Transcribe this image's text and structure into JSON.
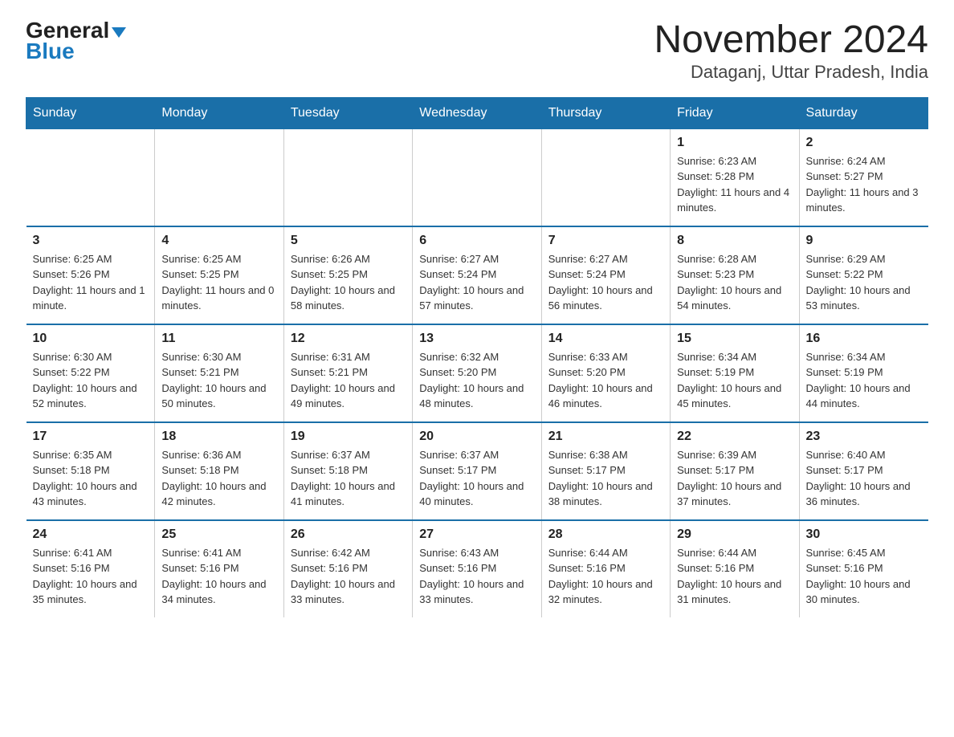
{
  "logo": {
    "general": "General",
    "blue": "Blue"
  },
  "title": "November 2024",
  "subtitle": "Dataganj, Uttar Pradesh, India",
  "weekdays": [
    "Sunday",
    "Monday",
    "Tuesday",
    "Wednesday",
    "Thursday",
    "Friday",
    "Saturday"
  ],
  "weeks": [
    [
      {
        "day": "",
        "info": ""
      },
      {
        "day": "",
        "info": ""
      },
      {
        "day": "",
        "info": ""
      },
      {
        "day": "",
        "info": ""
      },
      {
        "day": "",
        "info": ""
      },
      {
        "day": "1",
        "info": "Sunrise: 6:23 AM\nSunset: 5:28 PM\nDaylight: 11 hours and 4 minutes."
      },
      {
        "day": "2",
        "info": "Sunrise: 6:24 AM\nSunset: 5:27 PM\nDaylight: 11 hours and 3 minutes."
      }
    ],
    [
      {
        "day": "3",
        "info": "Sunrise: 6:25 AM\nSunset: 5:26 PM\nDaylight: 11 hours and 1 minute."
      },
      {
        "day": "4",
        "info": "Sunrise: 6:25 AM\nSunset: 5:25 PM\nDaylight: 11 hours and 0 minutes."
      },
      {
        "day": "5",
        "info": "Sunrise: 6:26 AM\nSunset: 5:25 PM\nDaylight: 10 hours and 58 minutes."
      },
      {
        "day": "6",
        "info": "Sunrise: 6:27 AM\nSunset: 5:24 PM\nDaylight: 10 hours and 57 minutes."
      },
      {
        "day": "7",
        "info": "Sunrise: 6:27 AM\nSunset: 5:24 PM\nDaylight: 10 hours and 56 minutes."
      },
      {
        "day": "8",
        "info": "Sunrise: 6:28 AM\nSunset: 5:23 PM\nDaylight: 10 hours and 54 minutes."
      },
      {
        "day": "9",
        "info": "Sunrise: 6:29 AM\nSunset: 5:22 PM\nDaylight: 10 hours and 53 minutes."
      }
    ],
    [
      {
        "day": "10",
        "info": "Sunrise: 6:30 AM\nSunset: 5:22 PM\nDaylight: 10 hours and 52 minutes."
      },
      {
        "day": "11",
        "info": "Sunrise: 6:30 AM\nSunset: 5:21 PM\nDaylight: 10 hours and 50 minutes."
      },
      {
        "day": "12",
        "info": "Sunrise: 6:31 AM\nSunset: 5:21 PM\nDaylight: 10 hours and 49 minutes."
      },
      {
        "day": "13",
        "info": "Sunrise: 6:32 AM\nSunset: 5:20 PM\nDaylight: 10 hours and 48 minutes."
      },
      {
        "day": "14",
        "info": "Sunrise: 6:33 AM\nSunset: 5:20 PM\nDaylight: 10 hours and 46 minutes."
      },
      {
        "day": "15",
        "info": "Sunrise: 6:34 AM\nSunset: 5:19 PM\nDaylight: 10 hours and 45 minutes."
      },
      {
        "day": "16",
        "info": "Sunrise: 6:34 AM\nSunset: 5:19 PM\nDaylight: 10 hours and 44 minutes."
      }
    ],
    [
      {
        "day": "17",
        "info": "Sunrise: 6:35 AM\nSunset: 5:18 PM\nDaylight: 10 hours and 43 minutes."
      },
      {
        "day": "18",
        "info": "Sunrise: 6:36 AM\nSunset: 5:18 PM\nDaylight: 10 hours and 42 minutes."
      },
      {
        "day": "19",
        "info": "Sunrise: 6:37 AM\nSunset: 5:18 PM\nDaylight: 10 hours and 41 minutes."
      },
      {
        "day": "20",
        "info": "Sunrise: 6:37 AM\nSunset: 5:17 PM\nDaylight: 10 hours and 40 minutes."
      },
      {
        "day": "21",
        "info": "Sunrise: 6:38 AM\nSunset: 5:17 PM\nDaylight: 10 hours and 38 minutes."
      },
      {
        "day": "22",
        "info": "Sunrise: 6:39 AM\nSunset: 5:17 PM\nDaylight: 10 hours and 37 minutes."
      },
      {
        "day": "23",
        "info": "Sunrise: 6:40 AM\nSunset: 5:17 PM\nDaylight: 10 hours and 36 minutes."
      }
    ],
    [
      {
        "day": "24",
        "info": "Sunrise: 6:41 AM\nSunset: 5:16 PM\nDaylight: 10 hours and 35 minutes."
      },
      {
        "day": "25",
        "info": "Sunrise: 6:41 AM\nSunset: 5:16 PM\nDaylight: 10 hours and 34 minutes."
      },
      {
        "day": "26",
        "info": "Sunrise: 6:42 AM\nSunset: 5:16 PM\nDaylight: 10 hours and 33 minutes."
      },
      {
        "day": "27",
        "info": "Sunrise: 6:43 AM\nSunset: 5:16 PM\nDaylight: 10 hours and 33 minutes."
      },
      {
        "day": "28",
        "info": "Sunrise: 6:44 AM\nSunset: 5:16 PM\nDaylight: 10 hours and 32 minutes."
      },
      {
        "day": "29",
        "info": "Sunrise: 6:44 AM\nSunset: 5:16 PM\nDaylight: 10 hours and 31 minutes."
      },
      {
        "day": "30",
        "info": "Sunrise: 6:45 AM\nSunset: 5:16 PM\nDaylight: 10 hours and 30 minutes."
      }
    ]
  ]
}
